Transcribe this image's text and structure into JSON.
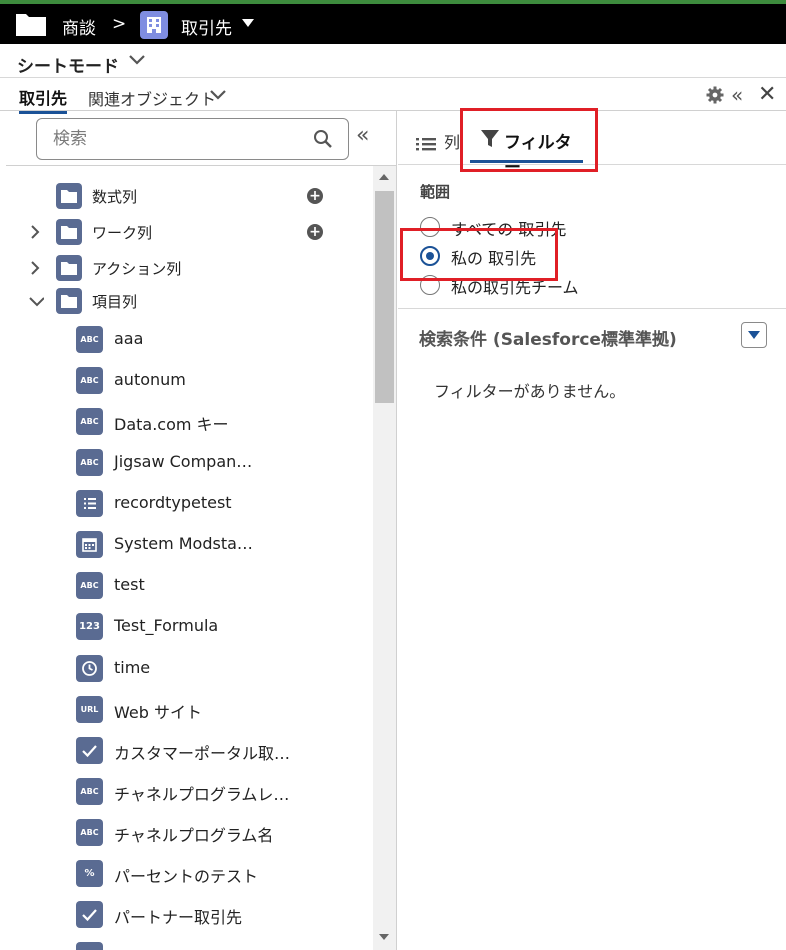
{
  "header": {
    "breadcrumb_1": "商談",
    "separator": ">",
    "breadcrumb_2": "取引先"
  },
  "modebar": {
    "label": "シートモード"
  },
  "tabs": {
    "object": "取引先",
    "related": "関連オブジェクト"
  },
  "search": {
    "placeholder": "検索"
  },
  "tree": {
    "groups": [
      {
        "label": "数式列",
        "expanded": false,
        "show_toggle": false
      },
      {
        "label": "ワーク列",
        "expanded": false
      },
      {
        "label": "アクション列",
        "expanded": false
      },
      {
        "label": "項目列",
        "expanded": true
      }
    ],
    "fields": [
      {
        "type": "ABC",
        "label": "aaa"
      },
      {
        "type": "ABC",
        "label": "autonum"
      },
      {
        "type": "ABC",
        "label": "Data.com キー"
      },
      {
        "type": "ABC",
        "label": "Jigsaw Compan…"
      },
      {
        "type": "picklist",
        "label": "recordtypetest"
      },
      {
        "type": "datetime",
        "label": "System Modsta…"
      },
      {
        "type": "ABC",
        "label": "test"
      },
      {
        "type": "123",
        "label": "Test_Formula"
      },
      {
        "type": "time",
        "label": "time"
      },
      {
        "type": "URL",
        "label": "Web サイト"
      },
      {
        "type": "checkbox",
        "label": "カスタマーポータル取…"
      },
      {
        "type": "ABC",
        "label": "チャネルプログラムレ…"
      },
      {
        "type": "ABC",
        "label": "チャネルプログラム名"
      },
      {
        "type": "%",
        "label": "パーセントのテスト"
      },
      {
        "type": "checkbox",
        "label": "パートナー取引先"
      }
    ]
  },
  "right": {
    "tab_columns": "列",
    "tab_filter": "フィルター",
    "scope_heading": "範囲",
    "scopes": [
      {
        "label": "すべての 取引先",
        "selected": false
      },
      {
        "label": "私の 取引先",
        "selected": true
      },
      {
        "label": "私の取引先チーム",
        "selected": false
      }
    ],
    "conditions_heading": "検索条件 (Salesforce標準準拠)",
    "no_filter_text": "フィルターがありません。"
  },
  "colors": {
    "accent": "#1b5297",
    "highlight": "#e01f26",
    "badge": "#5a6b92",
    "header_bg": "#000000"
  }
}
